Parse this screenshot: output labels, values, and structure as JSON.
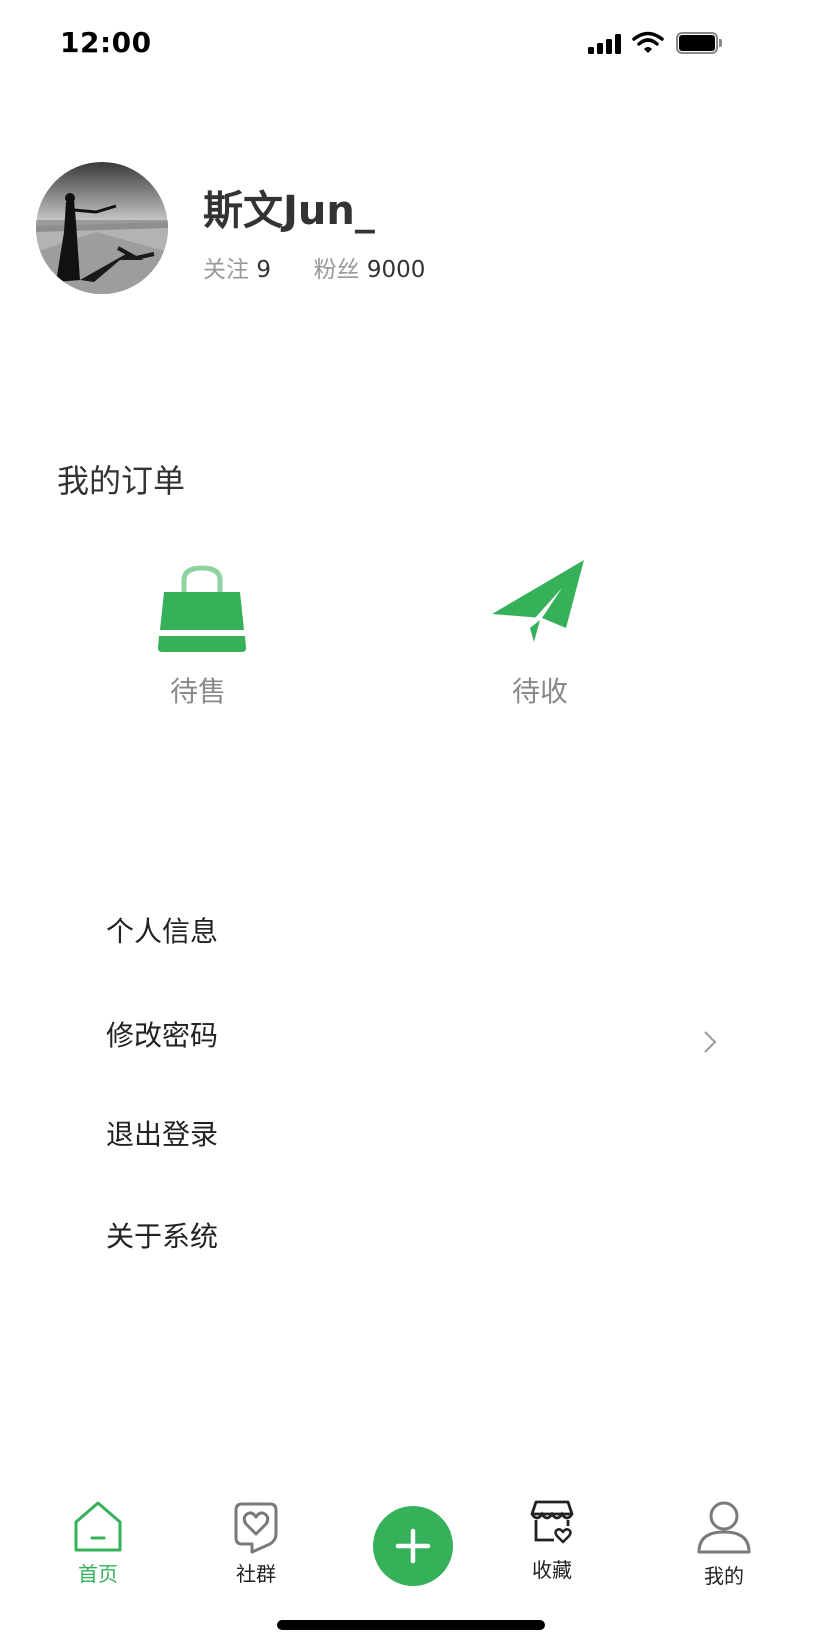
{
  "status_bar": {
    "time": "12:00"
  },
  "profile": {
    "username": "斯文Jun_",
    "following_label": "关注",
    "following_count": "9",
    "followers_label": "粉丝",
    "followers_count": "9000"
  },
  "orders": {
    "title": "我的订单",
    "items": [
      {
        "label": "待售",
        "icon": "shopping-bag-icon"
      },
      {
        "label": "待收",
        "icon": "paper-plane-icon"
      }
    ]
  },
  "menu": {
    "items": [
      {
        "label": "个人信息"
      },
      {
        "label": "修改密码"
      },
      {
        "label": "退出登录"
      },
      {
        "label": "关于系统"
      }
    ]
  },
  "tab_bar": {
    "items": [
      {
        "label": "首页",
        "icon": "home-icon",
        "active": true
      },
      {
        "label": "社群",
        "icon": "community-heart-icon",
        "active": false
      },
      {
        "label": "",
        "icon": "plus-icon",
        "active": false
      },
      {
        "label": "收藏",
        "icon": "store-heart-icon",
        "active": false
      },
      {
        "label": "我的",
        "icon": "user-icon",
        "active": false
      }
    ]
  },
  "colors": {
    "accent": "#36b15a",
    "text_primary": "#333333",
    "text_secondary": "#999999",
    "icon_gray": "#7a7a7a"
  }
}
